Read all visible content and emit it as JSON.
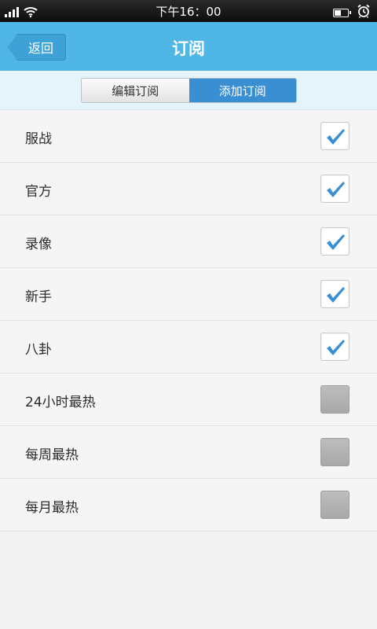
{
  "status_bar": {
    "time": "下午16：00",
    "signal_icon": "signal-icon",
    "wifi_icon": "wifi-icon",
    "battery_icon": "battery-icon",
    "alarm_icon": "alarm-icon"
  },
  "header": {
    "back_label": "返回",
    "title": "订阅"
  },
  "tabs": [
    {
      "label": "编辑订阅",
      "active": false
    },
    {
      "label": "添加订阅",
      "active": true
    }
  ],
  "subscriptions": [
    {
      "label": "服战",
      "checked": true
    },
    {
      "label": "官方",
      "checked": true
    },
    {
      "label": "录像",
      "checked": true
    },
    {
      "label": "新手",
      "checked": true
    },
    {
      "label": "八卦",
      "checked": true
    },
    {
      "label": "24小时最热",
      "checked": false
    },
    {
      "label": "每周最热",
      "checked": false
    },
    {
      "label": "每月最热",
      "checked": false
    }
  ],
  "colors": {
    "title_bar": "#50b6e6",
    "active_tab": "#3a8fd3",
    "check_mark": "#3a8fd3"
  }
}
